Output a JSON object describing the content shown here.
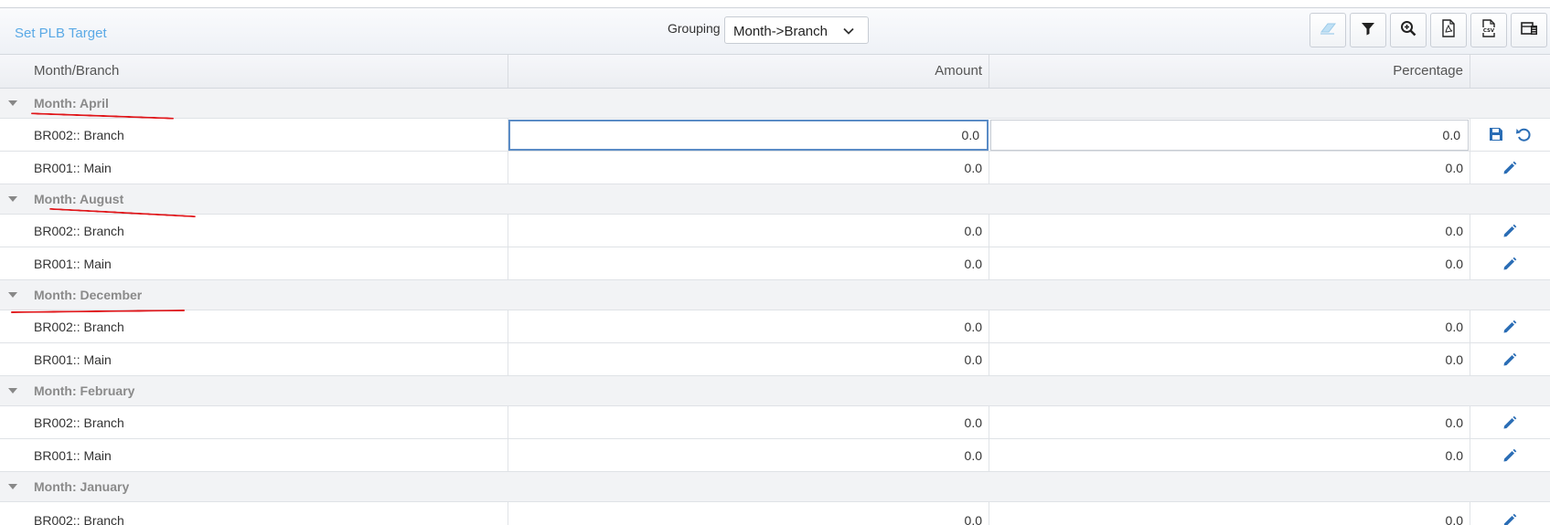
{
  "toolbar": {
    "title": "Set PLB Target",
    "grouping_label": "Grouping",
    "grouping_value": "Month->Branch",
    "buttons": [
      {
        "icon": "eraser-icon"
      },
      {
        "icon": "filter-icon"
      },
      {
        "icon": "zoom-in-icon"
      },
      {
        "icon": "pdf-icon"
      },
      {
        "icon": "csv-icon"
      },
      {
        "icon": "column-chooser-icon"
      }
    ]
  },
  "columns": {
    "name": "Month/Branch",
    "amount": "Amount",
    "percentage": "Percentage"
  },
  "groups": [
    {
      "label": "Month: April",
      "rows": [
        {
          "name": "BR002:: Branch",
          "amount": "0.0",
          "percentage": "0.0",
          "editing": true
        },
        {
          "name": "BR001:: Main",
          "amount": "0.0",
          "percentage": "0.0"
        }
      ]
    },
    {
      "label": "Month: August",
      "rows": [
        {
          "name": "BR002:: Branch",
          "amount": "0.0",
          "percentage": "0.0"
        },
        {
          "name": "BR001:: Main",
          "amount": "0.0",
          "percentage": "0.0"
        }
      ]
    },
    {
      "label": "Month: December",
      "rows": [
        {
          "name": "BR002:: Branch",
          "amount": "0.0",
          "percentage": "0.0"
        },
        {
          "name": "BR001:: Main",
          "amount": "0.0",
          "percentage": "0.0"
        }
      ]
    },
    {
      "label": "Month: February",
      "rows": [
        {
          "name": "BR002:: Branch",
          "amount": "0.0",
          "percentage": "0.0"
        },
        {
          "name": "BR001:: Main",
          "amount": "0.0",
          "percentage": "0.0"
        }
      ]
    },
    {
      "label": "Month: January",
      "rows": [
        {
          "name": "BR002:: Branch",
          "amount": "0.0",
          "percentage": "0.0"
        }
      ]
    }
  ],
  "colors": {
    "accent": "#5aa9e6",
    "action_icon": "#2a6db5",
    "annotation": "#e0161a"
  }
}
